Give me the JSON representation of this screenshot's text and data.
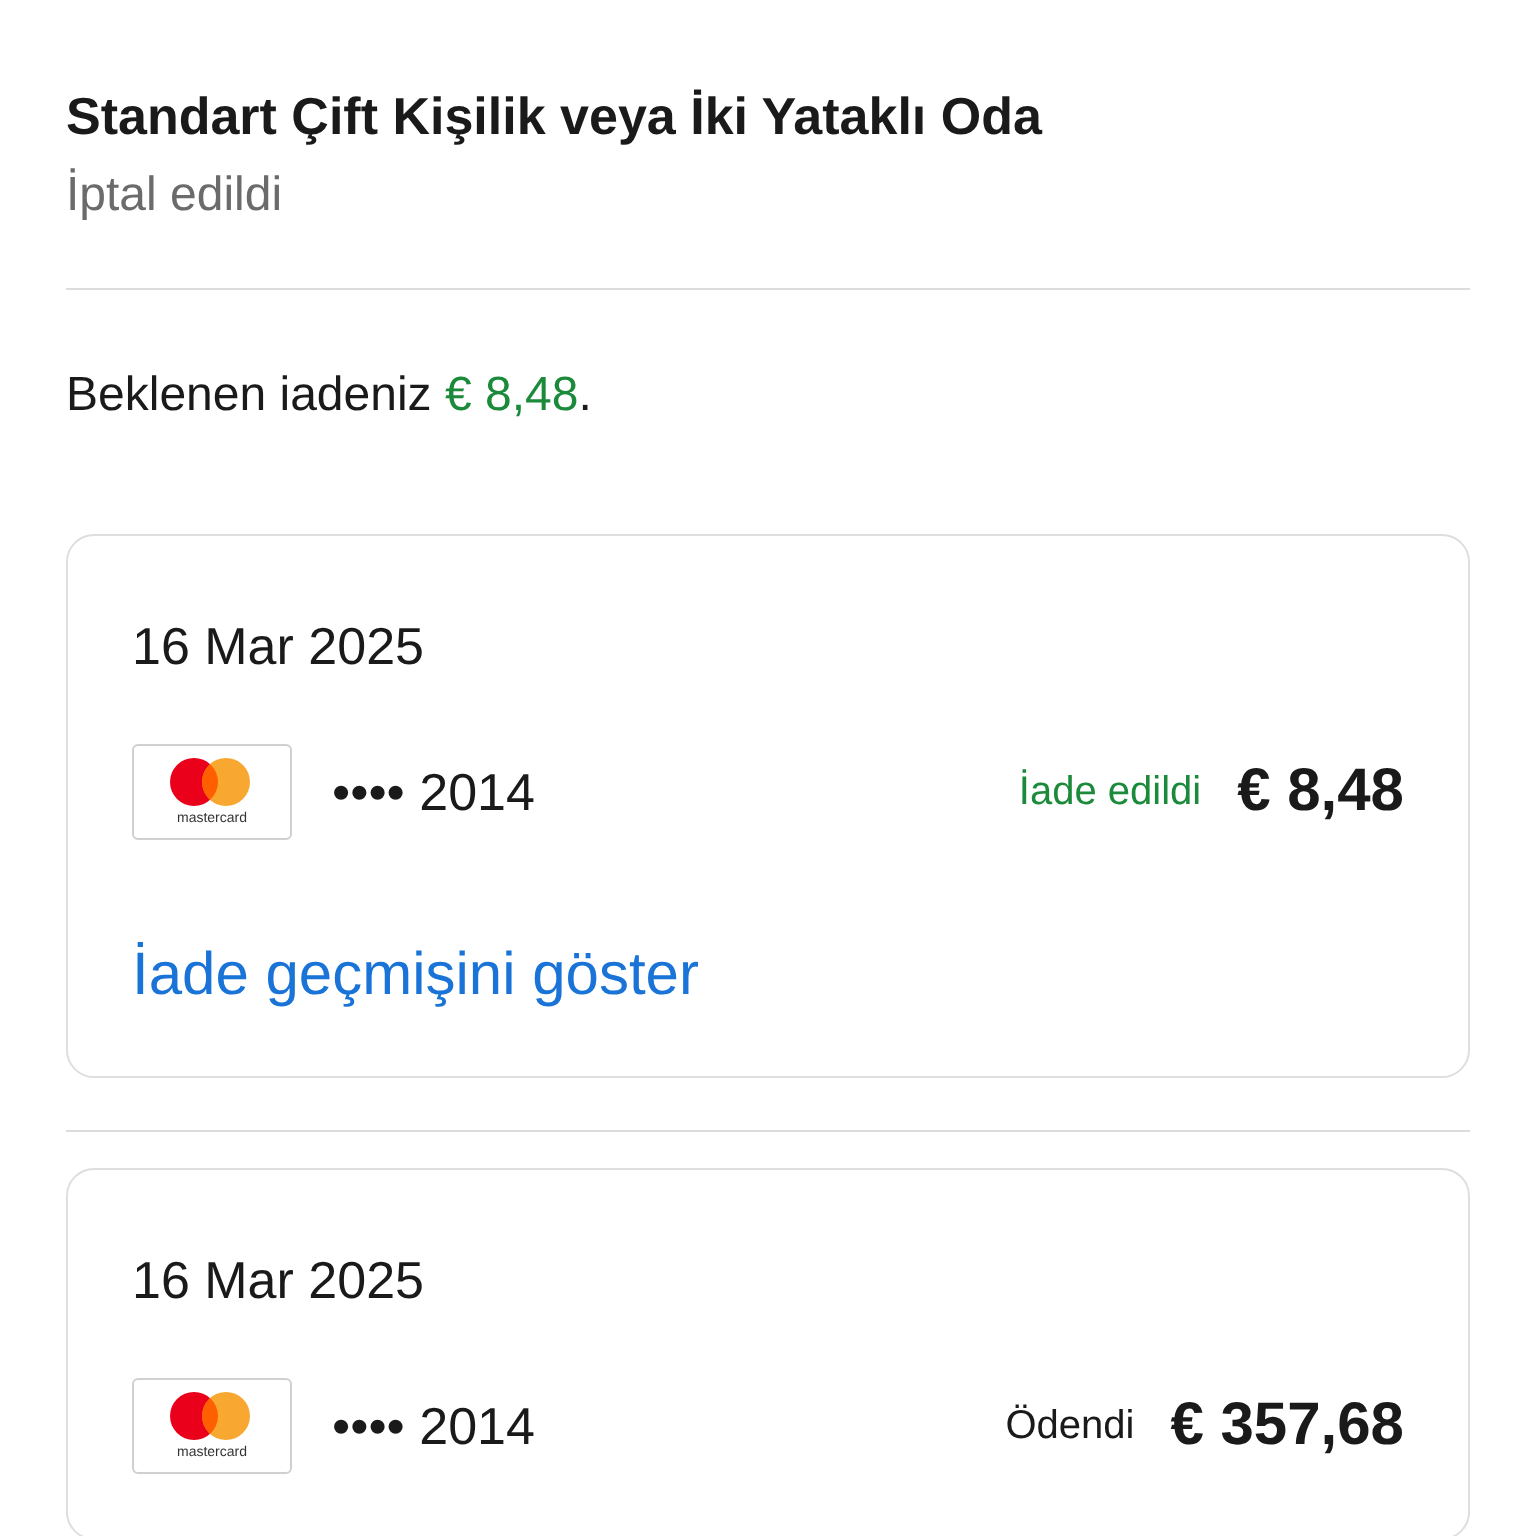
{
  "room": {
    "title": "Standart Çift Kişilik veya İki Yataklı Oda",
    "status": "İptal edildi"
  },
  "refund": {
    "prefix": "Beklenen iadeniz ",
    "amount": "€ 8,48",
    "suffix": "."
  },
  "payments": [
    {
      "date": "16 Mar 2025",
      "card_brand": "mastercard",
      "card_number": "•••• 2014",
      "status": "İade edildi",
      "kind": "refund",
      "amount": "€ 8,48",
      "link": "İade geçmişini göster"
    },
    {
      "date": "16 Mar 2025",
      "card_brand": "mastercard",
      "card_number": "•••• 2014",
      "status": "Ödendi",
      "kind": "payment",
      "amount": "€ 357,68"
    }
  ]
}
